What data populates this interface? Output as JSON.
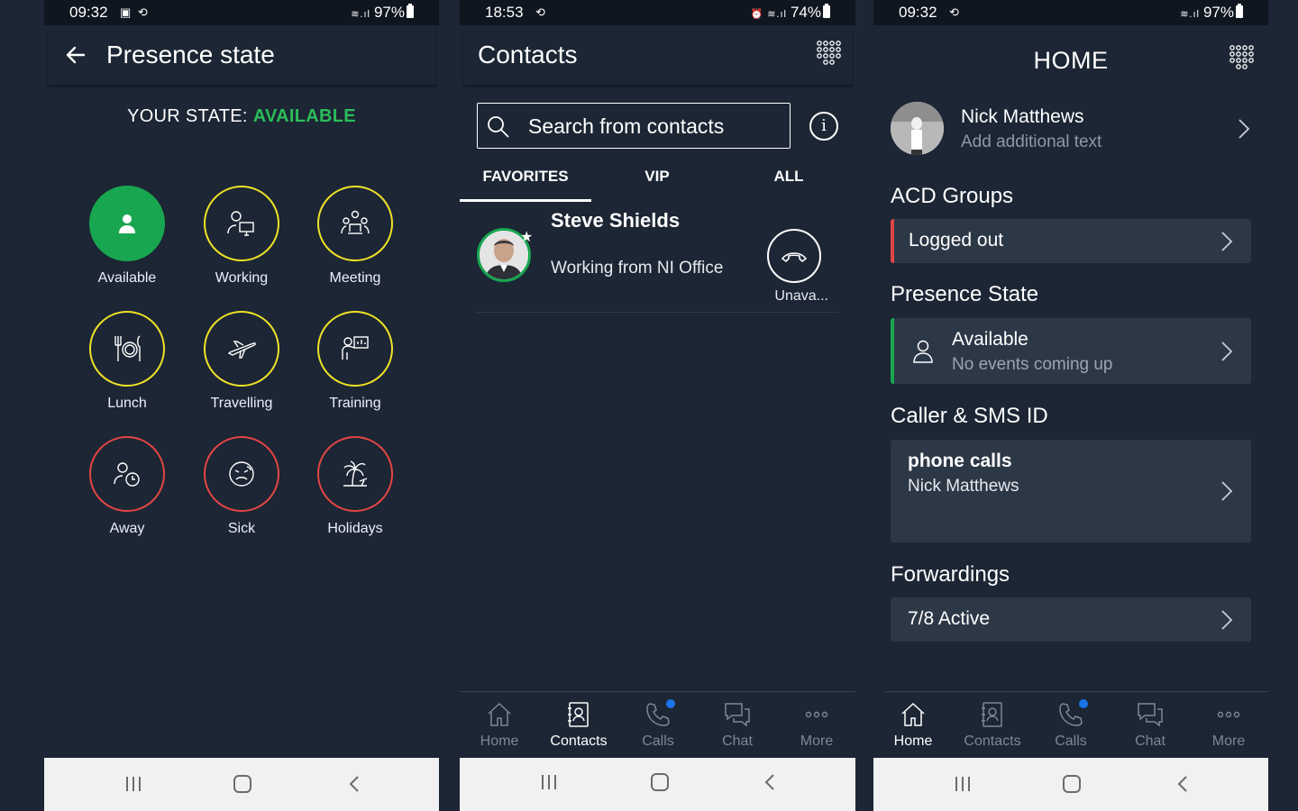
{
  "screen1": {
    "status": {
      "time": "09:32",
      "battery": "97%"
    },
    "title": "Presence state",
    "your_state_label": "YOUR STATE:",
    "your_state_value": "AVAILABLE",
    "states": [
      {
        "label": "Available",
        "icon": "person-icon",
        "ring": "green"
      },
      {
        "label": "Working",
        "icon": "person-desk-icon",
        "ring": "yellow"
      },
      {
        "label": "Meeting",
        "icon": "meeting-icon",
        "ring": "yellow"
      },
      {
        "label": "Lunch",
        "icon": "cutlery-icon",
        "ring": "yellow"
      },
      {
        "label": "Travelling",
        "icon": "airplane-icon",
        "ring": "yellow"
      },
      {
        "label": "Training",
        "icon": "training-icon",
        "ring": "yellow"
      },
      {
        "label": "Away",
        "icon": "person-clock-icon",
        "ring": "red"
      },
      {
        "label": "Sick",
        "icon": "sick-face-icon",
        "ring": "red"
      },
      {
        "label": "Holidays",
        "icon": "palm-tree-icon",
        "ring": "red"
      }
    ]
  },
  "screen2": {
    "status": {
      "time": "18:53",
      "battery": "74%"
    },
    "title": "Contacts",
    "search_placeholder": "Search from contacts",
    "tabs": [
      "FAVORITES",
      "VIP",
      "ALL"
    ],
    "active_tab": "FAVORITES",
    "contact": {
      "name": "Steve Shields",
      "status": "Working from NI Office",
      "call_label": "Unava..."
    },
    "nav": [
      "Home",
      "Contacts",
      "Calls",
      "Chat",
      "More"
    ],
    "nav_active": "Contacts"
  },
  "screen3": {
    "status": {
      "time": "09:32",
      "battery": "97%"
    },
    "title": "HOME",
    "user": {
      "name": "Nick Matthews",
      "sub": "Add additional text"
    },
    "acd": {
      "title": "ACD Groups",
      "value": "Logged out"
    },
    "presence": {
      "title": "Presence State",
      "value": "Available",
      "sub": "No events coming up"
    },
    "caller": {
      "title": "Caller & SMS ID",
      "label": "phone calls",
      "value": "Nick Matthews"
    },
    "forwardings": {
      "title": "Forwardings",
      "value": "7/8 Active"
    },
    "nav": [
      "Home",
      "Contacts",
      "Calls",
      "Chat",
      "More"
    ],
    "nav_active": "Home"
  },
  "colors": {
    "background": "#1c2634",
    "card": "#2d3847",
    "available": "#2bbd5a",
    "yellow_ring": "#f0e227",
    "red_ring": "#e44545",
    "badge": "#1a74e8"
  }
}
